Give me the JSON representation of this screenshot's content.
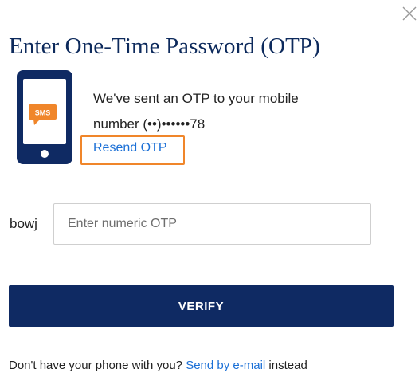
{
  "dialog": {
    "title": "Enter One-Time Password (OTP)"
  },
  "phone_illustration": {
    "bubble_text": "SMS",
    "colors": {
      "phone": "#0f2a63",
      "screen": "#ffffff",
      "bubble": "#f0862a"
    }
  },
  "message": {
    "line1": "We've sent an OTP to your mobile",
    "line2": "number (••)••••••78",
    "resend_label": "Resend OTP"
  },
  "otp_field": {
    "prefix": "bowj",
    "placeholder": "Enter numeric OTP",
    "value": ""
  },
  "verify_button": {
    "label": "VERIFY"
  },
  "footer": {
    "prompt": "Don't have your phone with you? ",
    "email_link": "Send by e-mail",
    "suffix": " instead"
  },
  "colors": {
    "brand_navy": "#0f2a63",
    "title_navy": "#0d2a5c",
    "link_blue": "#1a6fd6",
    "highlight_orange": "#f0862a"
  }
}
